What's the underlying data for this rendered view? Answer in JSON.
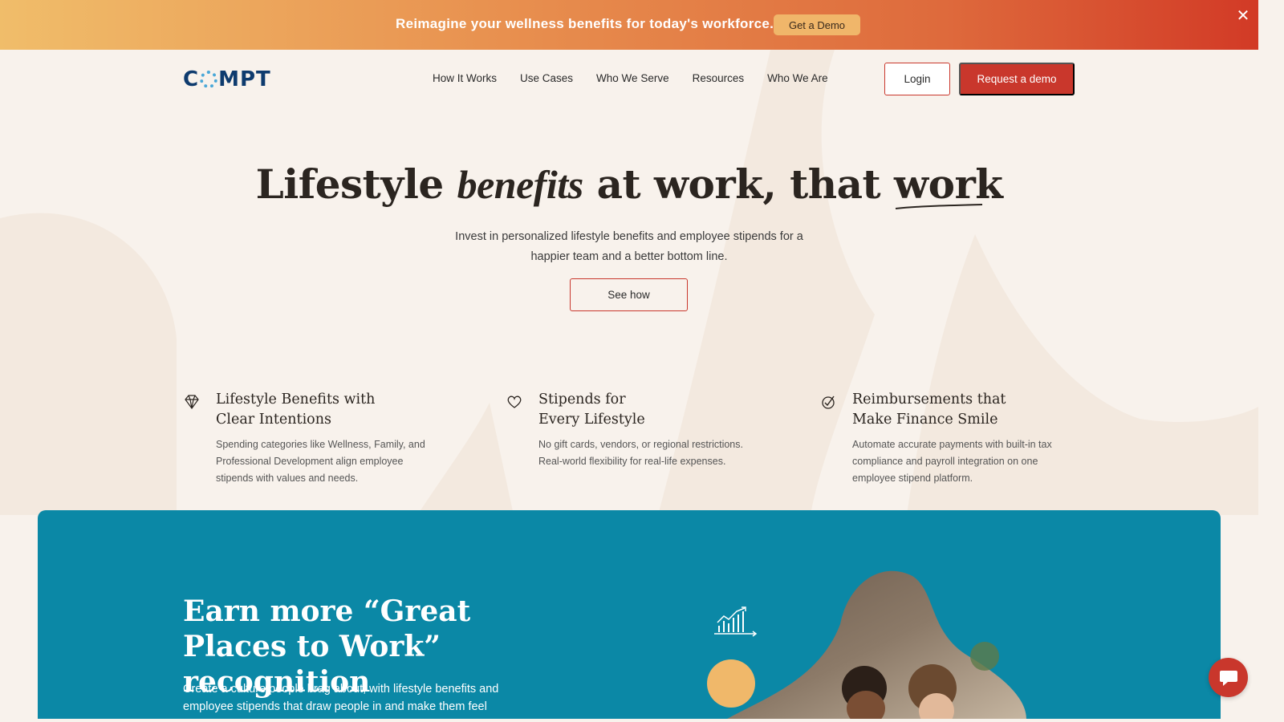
{
  "announcement": {
    "text": "Reimagine your wellness benefits for today's workforce.",
    "cta": "Get a Demo",
    "close_icon": "close-icon"
  },
  "header": {
    "logo_text_left": "C",
    "logo_text_right": "MPT",
    "nav": [
      "How It Works",
      "Use Cases",
      "Who We Serve",
      "Resources",
      "Who We Are"
    ],
    "login_label": "Login",
    "demo_label": "Request a demo"
  },
  "hero": {
    "title_part1": "Lifestyle",
    "title_script": "benefits",
    "title_part2": "at work, that",
    "title_underlined": "work",
    "subtitle": "Invest in personalized lifestyle benefits and employee stipends for a happier team and a better bottom line.",
    "cta": "See how"
  },
  "features": [
    {
      "icon": "diamond-icon",
      "title_line1": "Lifestyle Benefits with",
      "title_line2": "Clear Intentions",
      "body": "Spending categories like Wellness, Family, and Professional Development align employee stipends with values and needs."
    },
    {
      "icon": "heart-icon",
      "title_line1": "Stipends for",
      "title_line2": "Every Lifestyle",
      "body": "No gift cards, vendors, or regional restrictions. Real-world flexibility for real-life expenses."
    },
    {
      "icon": "check-circle-icon",
      "title_line1": "Reimbursements that",
      "title_line2": "Make Finance Smile",
      "body": "Automate accurate payments with built-in tax compliance and payroll integration on one employee stipend platform."
    }
  ],
  "recognition": {
    "title": "Earn more “Great Places to Work” recognition",
    "body": "Create a culture people brag about, with lifestyle benefits and employee stipends that draw people in and make them feel"
  },
  "colors": {
    "accent_red": "#c9372c",
    "teal": "#0b88a6",
    "background": "#f8f2ec"
  },
  "chat": {
    "icon": "chat-bubble-icon"
  }
}
